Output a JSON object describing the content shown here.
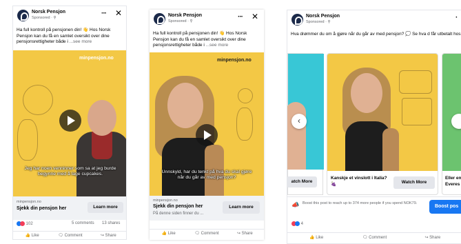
{
  "colors": {
    "yellow": "#f3c845",
    "teal": "#38c7d6",
    "blue": "#1877f2",
    "green": "#6cc36f"
  },
  "ad1": {
    "brand": "Norsk Pensjon",
    "sponsored": "Sponsored · ⚲",
    "menu": "···",
    "close": "✕",
    "text": "Ha full kontroll på pensjonen din! 👋 Hos Norsk Pensjon kan du få en samlet oversikt over dine pensjonsrettigheter både i",
    "see_more": "...see more",
    "domain": "minpensjon.no",
    "subtitle": "Jeg har noen venninner som sa at jeg burde begynne med å lage cupcakes.",
    "site": "minpensjon.no",
    "cta_text": "Sjekk din pensjon her",
    "button": "Learn more",
    "reactions": "102",
    "comments": "5 comments",
    "shares": "13 shares",
    "actions": [
      "Like",
      "Comment",
      "Share"
    ]
  },
  "ad2": {
    "brand": "Norsk Pensjon",
    "sponsored": "Sponsored · ⚲",
    "menu": "···",
    "close": "✕",
    "text": "Ha full kontroll på pensjonen din! 👋 Hos Norsk Pensjon kan du få en samlet oversikt over dine pensjonsrettigheter både i",
    "see_more": "...see more",
    "domain": "minpensjon.no",
    "subtitle": "Unnskyld, har du tenkt på hva du skal gjøre når du går av med pensjon?",
    "site": "minpensjon.no",
    "cta_text": "Sjekk din pensjon her",
    "cta_sub": "På denne siden finner du ...",
    "button": "Learn more",
    "actions": [
      "Like",
      "Comment",
      "Share"
    ]
  },
  "ad3": {
    "brand": "Norsk Pensjon",
    "sponsored": "Sponsored · ⚲",
    "text": "Hva drømmer du om å gjøre når du går av med pensjon? 💭 Se hva d får utbetalt hos oss!",
    "left_button": "atch More",
    "card_title": "Kanskje et vinslott i Italia? 🍇",
    "card_button": "Watch More",
    "right_title": "Eller en Everes",
    "boost_text": "Boost this post to reach up to 374 more people if you spend NOK79.",
    "boost_button": "Boost pos",
    "reactions": "4",
    "actions": [
      "Like",
      "Comment",
      "Share"
    ]
  }
}
